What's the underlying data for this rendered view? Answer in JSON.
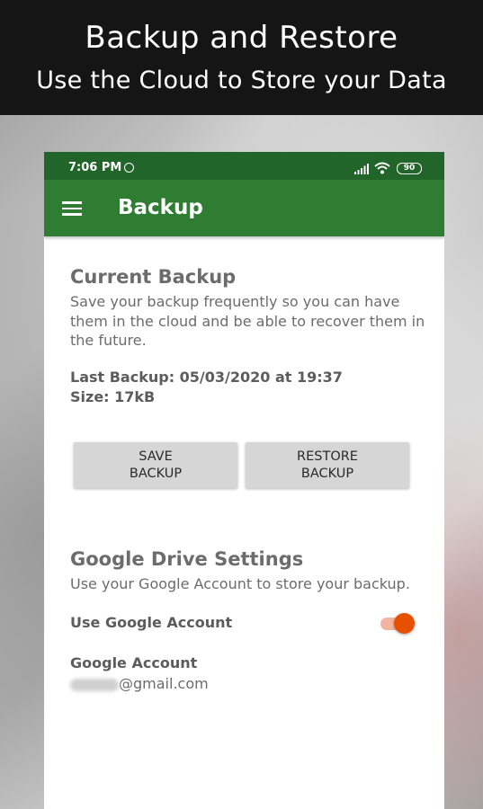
{
  "promo": {
    "title": "Backup and Restore",
    "subtitle": "Use the Cloud to Store your Data"
  },
  "status_bar": {
    "time": "7:06 PM",
    "battery": "90",
    "icons": [
      "alarm-icon",
      "signal-icon",
      "wifi-icon",
      "battery-icon"
    ]
  },
  "app_bar": {
    "title": "Backup",
    "menu_icon": "hamburger-menu-icon"
  },
  "current_backup": {
    "title": "Current Backup",
    "description": "Save your backup frequently so you can have them in the cloud and be able to recover them in the future.",
    "last_backup": "Last Backup: 05/03/2020 at 19:37",
    "size": "Size: 17kB",
    "save_button": "SAVE BACKUP",
    "restore_button": "RESTORE BACKUP"
  },
  "google_drive": {
    "title": "Google Drive Settings",
    "description": "Use your Google Account to store your backup.",
    "toggle_label": "Use Google Account",
    "toggle_on": true,
    "account_label": "Google Account",
    "account_email_suffix": "@gmail.com"
  },
  "colors": {
    "status_bar": "#22652a",
    "app_bar": "#2e7d32",
    "toggle_thumb": "#e65100",
    "toggle_track": "#f4b5a0",
    "banner": "#151515"
  }
}
